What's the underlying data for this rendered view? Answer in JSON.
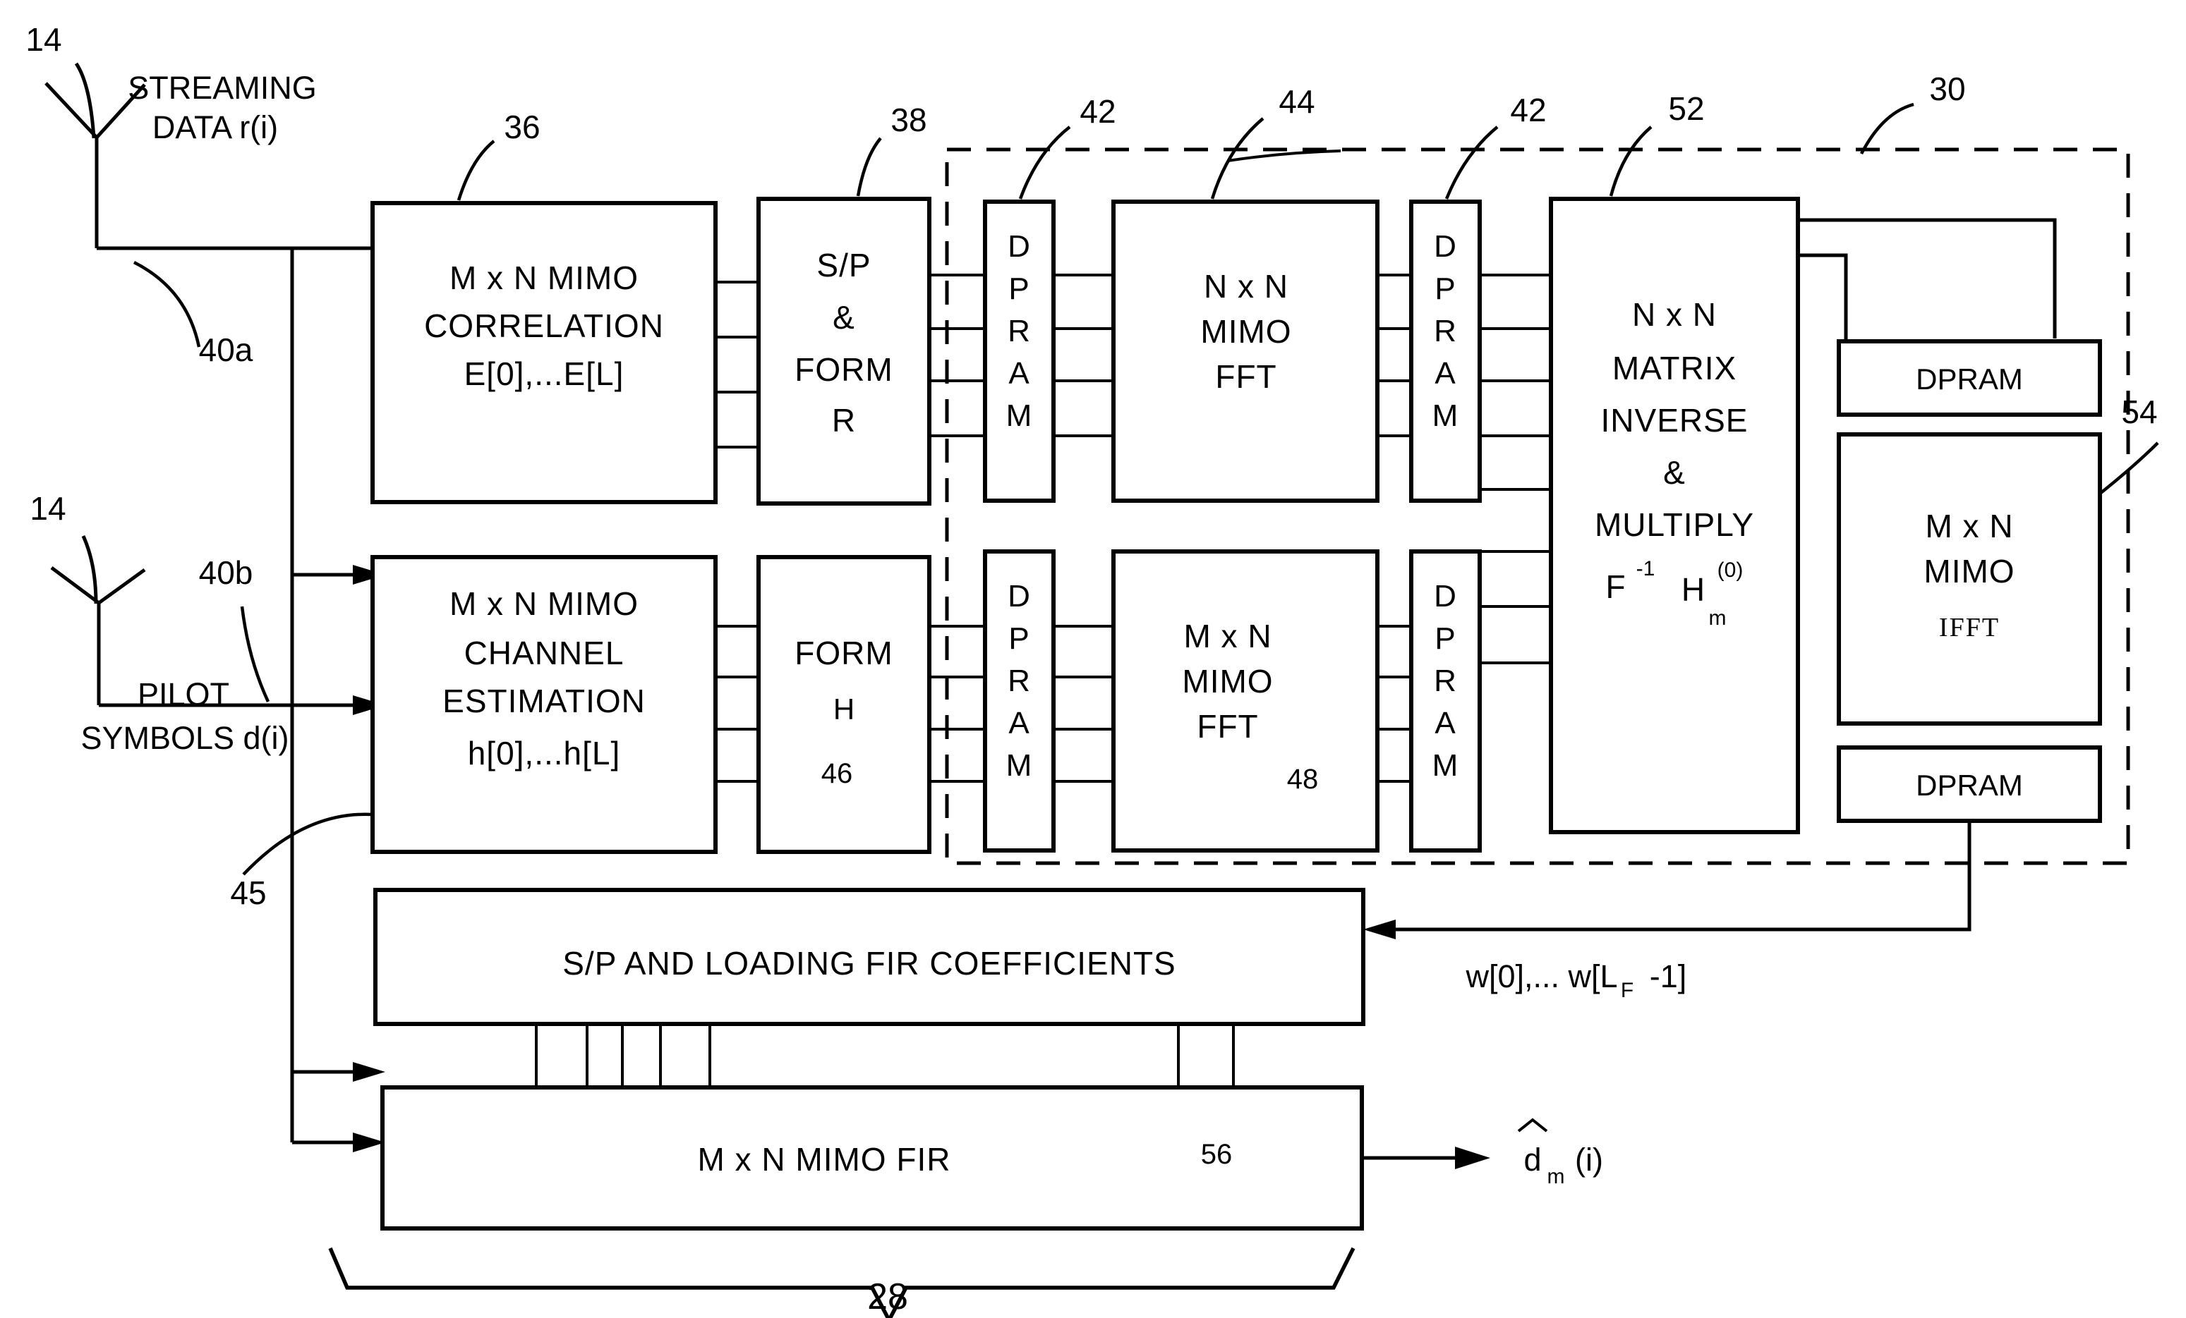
{
  "figure": {
    "kind": "patent-block-diagram",
    "antennas": [
      {
        "ref": "14",
        "signal_line1": "STREAMING",
        "signal_line2": "DATA r(i)"
      },
      {
        "ref": "14",
        "signal_line1": "PILOT",
        "signal_line2": "SYMBOLS d(i)"
      }
    ],
    "blocks": {
      "correlation": {
        "ref": "36",
        "line1": "M x N MIMO",
        "line2": "CORRELATION",
        "line3": "E[0],...E[L]"
      },
      "sp_form_r": {
        "ref": "38",
        "line1": "S/P",
        "line2": "&",
        "line3": "FORM",
        "line4": "R"
      },
      "dpram_top_left": {
        "ref": "42",
        "label": "DPRAM"
      },
      "nxn_fft": {
        "ref": "44",
        "line1": "N x N",
        "line2": "MIMO",
        "line3": "FFT"
      },
      "dpram_top_right": {
        "ref": "42",
        "label": "DPRAM"
      },
      "matrix_inverse": {
        "ref": "52",
        "line1": "N x N",
        "line2": "MATRIX",
        "line3": "INVERSE",
        "line4": "&",
        "line5": "MULTIPLY",
        "formula_base": "F",
        "formula_sup": "-1",
        "formula_H": "H",
        "formula_H_sup": "(0)",
        "formula_H_sub": "m"
      },
      "dpram_right_upper": {
        "label": "DPRAM"
      },
      "mimo_ifft": {
        "ref": "54",
        "line1": "M x N",
        "line2": "MIMO",
        "line3": "IFFT"
      },
      "dpram_right_lower": {
        "label": "DPRAM"
      },
      "channel_estimation": {
        "line1": "M x N MIMO",
        "line2": "CHANNEL",
        "line3": "ESTIMATION",
        "line4": "h[0],...h[L]"
      },
      "form_h": {
        "ref": "46",
        "line1": "FORM",
        "line2": "H"
      },
      "dpram_bot_left": {
        "label": "DPRAM"
      },
      "mxn_fft": {
        "ref": "48",
        "line1": "M x N",
        "line2": "MIMO",
        "line3": "FFT"
      },
      "dpram_bot_right": {
        "label": "DPRAM"
      },
      "sp_loading_fir": {
        "label": "S/P AND LOADING FIR COEFFICIENTS"
      },
      "mimo_fir": {
        "ref": "56",
        "label": "M x N MIMO FIR"
      }
    },
    "dashed_group": {
      "ref": "30"
    },
    "callouts": {
      "lead_40a": "40a",
      "lead_40b": "40b",
      "lead_45": "45",
      "brace_28": "28"
    },
    "signals": {
      "fir_coeffs": "w[0],... w[L",
      "fir_coeffs_sub": "F",
      "fir_coeffs_tail": "-1]",
      "output_base": "d",
      "output_sub": "m",
      "output_tail": "(i)"
    }
  }
}
